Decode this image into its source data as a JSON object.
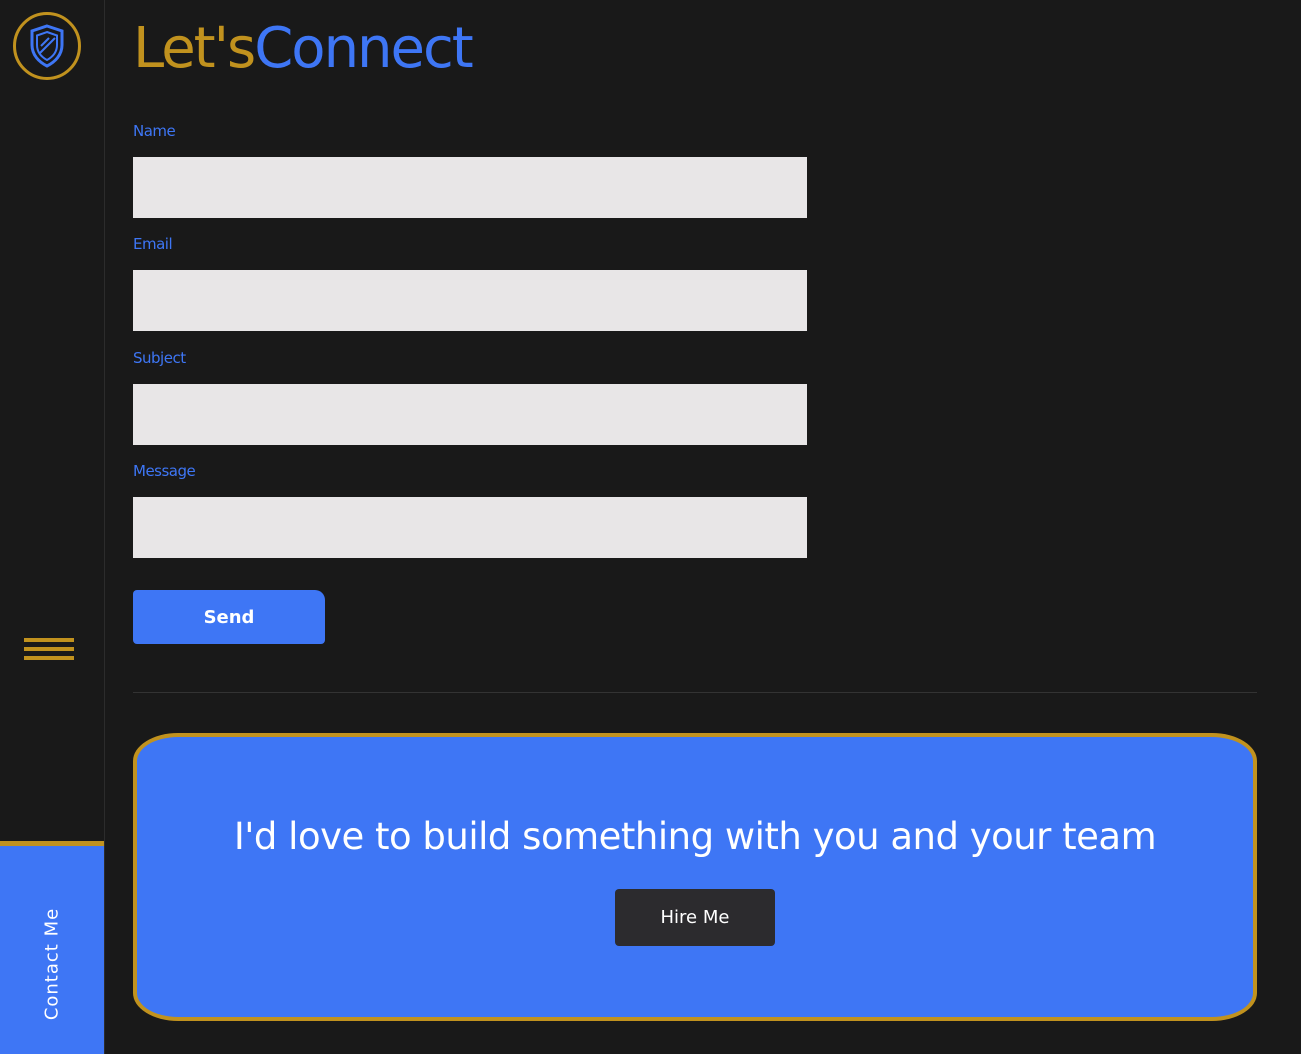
{
  "brand": {
    "logo_icon": "shield-icon",
    "accent_color": "#c1921e",
    "primary_color": "#3e76f5"
  },
  "nav": {
    "menu_icon": "hamburger-menu-icon",
    "contact_tab_label": "Contact Me"
  },
  "header": {
    "title_part1": "Let's",
    "title_part2": "Connect"
  },
  "form": {
    "fields": [
      {
        "label": "Name",
        "value": "",
        "placeholder": ""
      },
      {
        "label": "Email",
        "value": "",
        "placeholder": ""
      },
      {
        "label": "Subject",
        "value": "",
        "placeholder": ""
      },
      {
        "label": "Message",
        "value": "",
        "placeholder": ""
      }
    ],
    "submit_label": "Send"
  },
  "cta": {
    "text": "I'd love to build something with you and your team",
    "button_label": "Hire Me"
  }
}
